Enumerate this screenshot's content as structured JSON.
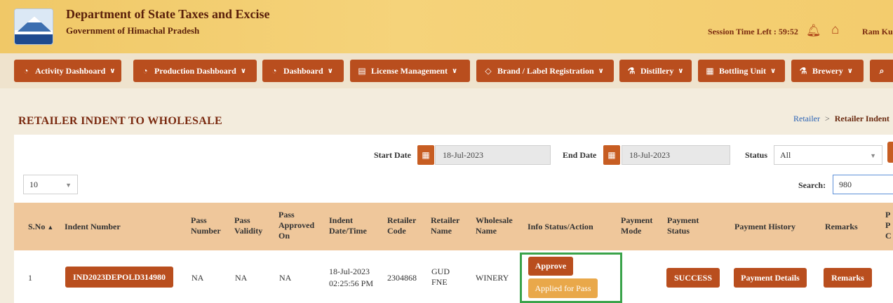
{
  "header": {
    "title": "Department of State Taxes and Excise",
    "subtitle": "Government of Himachal Pradesh",
    "session": "Session Time Left : 59:52",
    "bell_icon": "bell-icon",
    "home_icon": "home-icon",
    "user": "Ram Ku"
  },
  "nav": {
    "items": [
      {
        "label": "Activity Dashboard",
        "icon": "dashboard-icon"
      },
      {
        "label": "Production Dashboard",
        "icon": "dashboard-icon"
      },
      {
        "label": "Dashboard",
        "icon": "dashboard-icon"
      },
      {
        "label": "License Management",
        "icon": "license-icon"
      },
      {
        "label": "Brand / Label Registration",
        "icon": "tag-icon"
      },
      {
        "label": "Distillery",
        "icon": "distillery-icon"
      },
      {
        "label": "Bottling Unit",
        "icon": "bottling-icon"
      },
      {
        "label": "Brewery",
        "icon": "brewery-icon"
      }
    ]
  },
  "page": {
    "title": "RETAILER INDENT TO WHOLESALE",
    "breadcrumb_link": "Retailer",
    "breadcrumb_sep": ">",
    "breadcrumb_current": "Retailer Indent"
  },
  "filters": {
    "start_label": "Start Date",
    "start_value": "18-Jul-2023",
    "end_label": "End Date",
    "end_value": "18-Jul-2023",
    "status_label": "Status",
    "status_value": "All",
    "page_size": "10",
    "search_label": "Search:",
    "search_value": "980"
  },
  "table": {
    "headers": {
      "sno": "S.No",
      "indent_number": "Indent Number",
      "pass_number": "Pass Number",
      "pass_validity": "Pass Validity",
      "pass_approved_on": "Pass Approved On",
      "indent_datetime": "Indent Date/Time",
      "retailer_code": "Retailer Code",
      "retailer_name": "Retailer Name",
      "wholesale_name": "Wholesale Name",
      "info_status": "Info Status/Action",
      "payment_mode": "Payment Mode",
      "payment_status": "Payment Status",
      "payment_history": "Payment History",
      "remarks": "Remarks",
      "extra": "P P C"
    },
    "row": {
      "sno": "1",
      "indent_number": "IND2023DEPOLD314980",
      "pass_number": "NA",
      "pass_validity": "NA",
      "pass_approved_on": "NA",
      "indent_date": "18-Jul-2023",
      "indent_time": "02:25:56 PM",
      "retailer_code": "2304868",
      "retailer_name": "GUD FNE",
      "wholesale_name": "WINERY",
      "approve_label": "Approve",
      "applied_label": "Applied for Pass",
      "payment_mode": "",
      "payment_status": "SUCCESS",
      "payment_history": "Payment Details",
      "remarks": "Remarks"
    }
  }
}
